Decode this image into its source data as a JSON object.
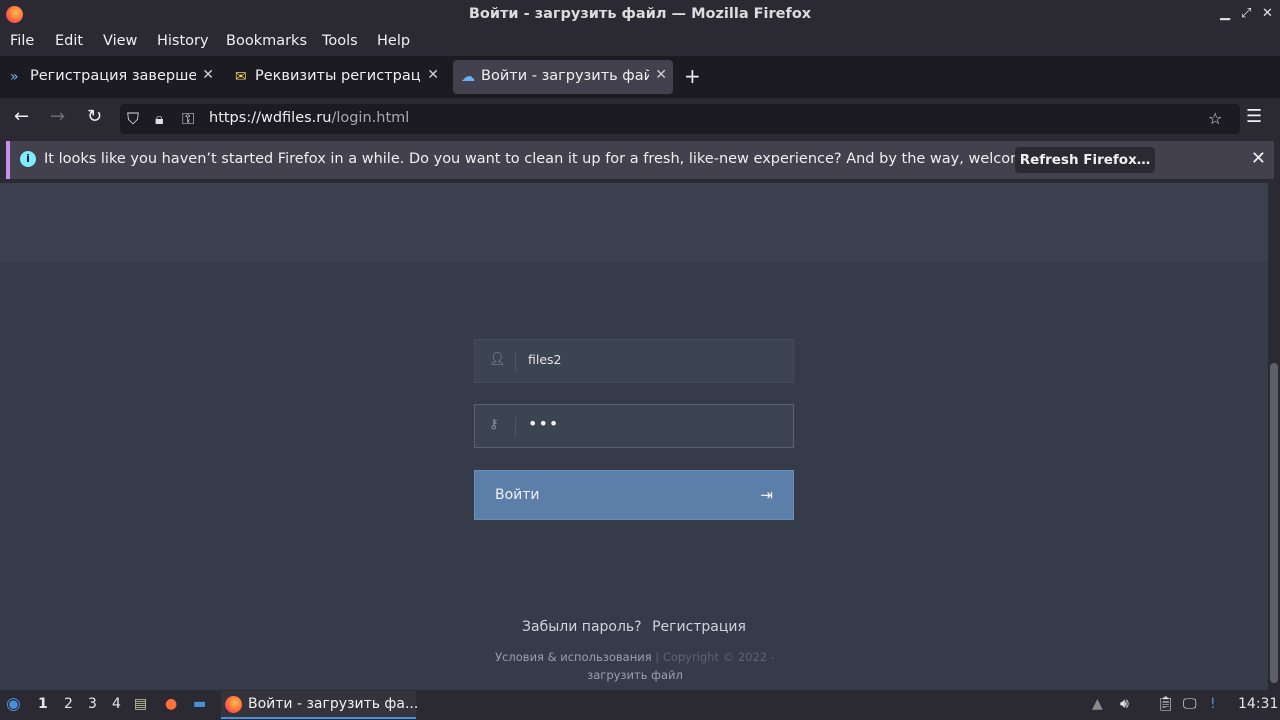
{
  "window": {
    "title": "Войти - загрузить файл — Mozilla Firefox"
  },
  "menu": [
    "File",
    "Edit",
    "View",
    "History",
    "Bookmarks",
    "Tools",
    "Help"
  ],
  "tabs": [
    {
      "label": "Регистрация завершена",
      "icon": "double-chevron-icon"
    },
    {
      "label": "Реквизиты регистрации",
      "icon": "envelope-icon"
    },
    {
      "label": "Войти - загрузить файл",
      "icon": "cloud-icon"
    }
  ],
  "urlbar": {
    "host": "https://wdfiles.ru",
    "path": "/login.html"
  },
  "notification": {
    "message": "It looks like you haven’t started Firefox in a while. Do you want to clean it up for a fresh, like-new experience? And by the way, welcome back!",
    "button": "Refresh Firefox…"
  },
  "login": {
    "username": "files2",
    "password_mask": "•••",
    "submit": "Войти"
  },
  "links": {
    "forgot": "Забыли пароль?",
    "register": "Регистрация"
  },
  "footer": {
    "terms": "Условия & использования",
    "copyright": "Copyright © 2022 -",
    "brand": "загрузить файл"
  },
  "taskbar": {
    "workspaces": [
      "1",
      "2",
      "3",
      "4"
    ],
    "window_label": "Войти - загрузить фа...",
    "clock": "14:31"
  }
}
